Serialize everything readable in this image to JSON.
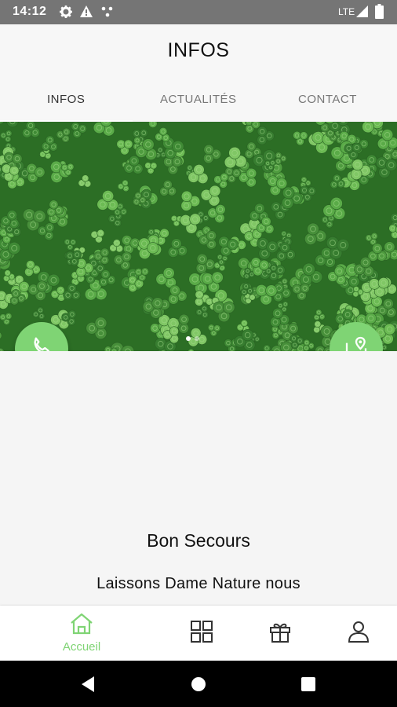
{
  "status_bar": {
    "time": "14:12",
    "network": "LTE",
    "icons": [
      "settings-icon",
      "alert-icon",
      "signal-dots-icon",
      "cell-signal-icon",
      "battery-icon"
    ]
  },
  "header": {
    "title": "INFOS",
    "tabs": [
      {
        "label": "INFOS",
        "active": true
      },
      {
        "label": "ACTUALITÉS",
        "active": false
      },
      {
        "label": "CONTACT",
        "active": false
      }
    ]
  },
  "hero": {
    "image": "green clover leaves",
    "carousel_pages": 2,
    "carousel_current": 1
  },
  "actions": {
    "call_icon": "phone-icon",
    "map_icon": "map-pin-icon"
  },
  "content": {
    "place_name": "Bon Secours",
    "description": "Laissons Dame Nature nous"
  },
  "bottom_nav": {
    "items": [
      {
        "label": "Accueil",
        "icon": "home-icon",
        "active": true
      },
      {
        "label": "",
        "icon": "grid-icon",
        "active": false
      },
      {
        "label": "",
        "icon": "gift-icon",
        "active": false
      },
      {
        "label": "",
        "icon": "user-icon",
        "active": false
      }
    ]
  },
  "colors": {
    "accent": "#7fd474",
    "status_bar": "#757575",
    "nav_bar": "#000000"
  }
}
